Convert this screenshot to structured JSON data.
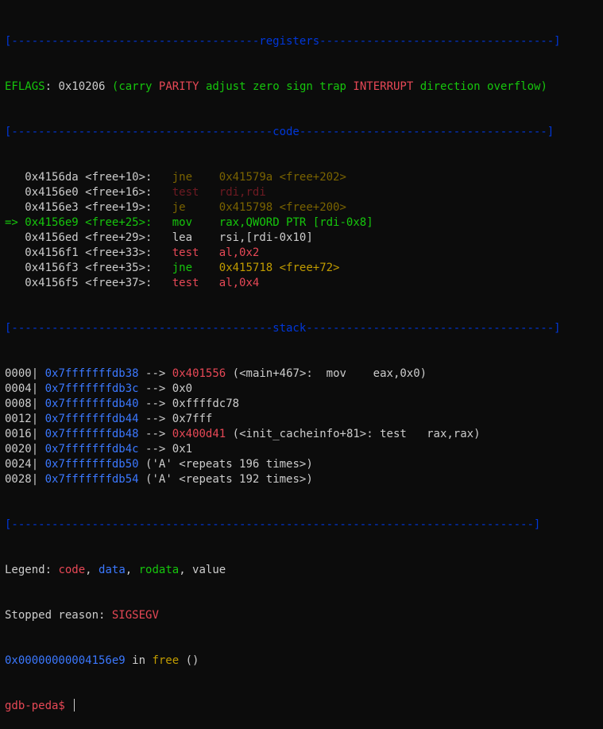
{
  "separators": {
    "registers": "[-------------------------------------registers-----------------------------------]",
    "code": "[---------------------------------------code-------------------------------------]",
    "stack": "[---------------------------------------stack-------------------------------------]",
    "end": "[------------------------------------------------------------------------------]"
  },
  "eflags": {
    "label": "EFLAGS",
    "value": "0x10206",
    "flags": [
      {
        "name": "carry",
        "set": false
      },
      {
        "name": "PARITY",
        "set": true
      },
      {
        "name": "adjust",
        "set": false
      },
      {
        "name": "zero",
        "set": false
      },
      {
        "name": "sign",
        "set": false
      },
      {
        "name": "trap",
        "set": false
      },
      {
        "name": "INTERRUPT",
        "set": true
      },
      {
        "name": "direction",
        "set": false
      },
      {
        "name": "overflow",
        "set": false
      }
    ]
  },
  "code": [
    {
      "marker": "",
      "addr": "0x4156da",
      "sym": "<free+10>:",
      "mnemonic": "jne",
      "operands": "0x41579a <free+202>",
      "style": "past-jump"
    },
    {
      "marker": "",
      "addr": "0x4156e0",
      "sym": "<free+16>:",
      "mnemonic": "test",
      "operands": "rdi,rdi",
      "style": "past-test"
    },
    {
      "marker": "",
      "addr": "0x4156e3",
      "sym": "<free+19>:",
      "mnemonic": "je",
      "operands": "0x415798 <free+200>",
      "style": "past-jump"
    },
    {
      "marker": "=>",
      "addr": "0x4156e9",
      "sym": "<free+25>:",
      "mnemonic": "mov",
      "operands": "rax,QWORD PTR [rdi-0x8]",
      "style": "current"
    },
    {
      "marker": "",
      "addr": "0x4156ed",
      "sym": "<free+29>:",
      "mnemonic": "lea",
      "operands": "rsi,[rdi-0x10]",
      "style": "normal"
    },
    {
      "marker": "",
      "addr": "0x4156f1",
      "sym": "<free+33>:",
      "mnemonic": "test",
      "operands": "al,0x2",
      "style": "test"
    },
    {
      "marker": "",
      "addr": "0x4156f3",
      "sym": "<free+35>:",
      "mnemonic": "jne",
      "operands": "0x415718 <free+72>",
      "style": "jump"
    },
    {
      "marker": "",
      "addr": "0x4156f5",
      "sym": "<free+37>:",
      "mnemonic": "test",
      "operands": "al,0x4",
      "style": "test"
    }
  ],
  "stack": [
    {
      "offset": "0000|",
      "addr": "0x7fffffffdb38",
      "arrow": "-->",
      "value": "0x401556",
      "value_color": "code",
      "extra": "(<main+467>:  mov    eax,0x0)"
    },
    {
      "offset": "0004|",
      "addr": "0x7fffffffdb3c",
      "arrow": "-->",
      "value": "0x0",
      "value_color": "value",
      "extra": ""
    },
    {
      "offset": "0008|",
      "addr": "0x7fffffffdb40",
      "arrow": "-->",
      "value": "0xffffdc78",
      "value_color": "value",
      "extra": ""
    },
    {
      "offset": "0012|",
      "addr": "0x7fffffffdb44",
      "arrow": "-->",
      "value": "0x7fff",
      "value_color": "value",
      "extra": ""
    },
    {
      "offset": "0016|",
      "addr": "0x7fffffffdb48",
      "arrow": "-->",
      "value": "0x400d41",
      "value_color": "code",
      "extra": "(<init_cacheinfo+81>: test   rax,rax)"
    },
    {
      "offset": "0020|",
      "addr": "0x7fffffffdb4c",
      "arrow": "-->",
      "value": "0x1",
      "value_color": "value",
      "extra": ""
    },
    {
      "offset": "0024|",
      "addr": "0x7fffffffdb50",
      "arrow": "",
      "value": "('A' <repeats 196 times>)",
      "value_color": "value",
      "extra": ""
    },
    {
      "offset": "0028|",
      "addr": "0x7fffffffdb54",
      "arrow": "",
      "value": "('A' <repeats 192 times>)",
      "value_color": "value",
      "extra": ""
    }
  ],
  "legend": {
    "label": "Legend:",
    "code": "code",
    "data": "data",
    "rodata": "rodata",
    "value": "value"
  },
  "stopped": {
    "label": "Stopped reason:",
    "reason": "SIGSEGV"
  },
  "location": {
    "addr": "0x00000000004156e9",
    "in": "in",
    "func": "free",
    "args": "()"
  },
  "prompt": "gdb-peda$",
  "colors": {
    "background": "#0c0c0c",
    "code": "#e74856",
    "data": "#3b78ff",
    "rodata": "#16c60c",
    "value": "#cccccc",
    "separator": "#0037da"
  }
}
